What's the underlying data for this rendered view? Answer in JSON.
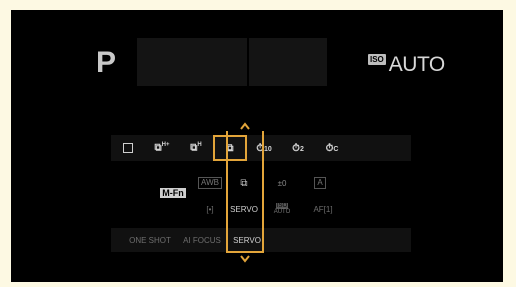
{
  "shooting_mode": "P",
  "iso": {
    "badge": "ISO",
    "value": "AUTO"
  },
  "drive_modes": [
    {
      "label": "□",
      "icon": "single-shot-icon"
    },
    {
      "label": "⧉H+",
      "icon": "high-speed-plus-icon"
    },
    {
      "label": "⧉H",
      "icon": "high-speed-icon"
    },
    {
      "label": "⧉",
      "icon": "continuous-icon",
      "selected": true
    },
    {
      "label": "⏱10",
      "icon": "self-timer-10-icon"
    },
    {
      "label": "⏱2",
      "icon": "self-timer-2-icon"
    },
    {
      "label": "⏱C",
      "icon": "self-timer-continuous-icon"
    }
  ],
  "mfn_label": "M-Fn",
  "settings_row1": {
    "wb": "AWB",
    "drive": "⧉",
    "exposure": "±0",
    "picture_style": "A"
  },
  "settings_row2": {
    "metering": "[•]",
    "af_mode": "SERVO",
    "iso_badge": "ISO",
    "iso_value": "AUTO",
    "af_area": "AF[1]"
  },
  "af_options": [
    "ONE SHOT",
    "AI FOCUS",
    "SERVO"
  ],
  "af_selected": "SERVO"
}
